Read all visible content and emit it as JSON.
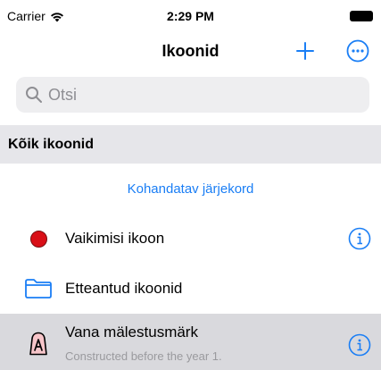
{
  "status_bar": {
    "carrier": "Carrier",
    "time": "2:29 PM"
  },
  "nav": {
    "title": "Ikoonid",
    "add_icon": "plus-icon",
    "more_icon": "ellipsis-circle-icon"
  },
  "search": {
    "placeholder": "Otsi",
    "value": ""
  },
  "section": {
    "header": "Kõik ikoonid",
    "reorder_label": "Kohandatav järjekord"
  },
  "rows": [
    {
      "label": "Vaikimisi ikoon",
      "icon": "red-dot-icon",
      "has_info": true
    },
    {
      "label": "Etteantud ikoonid",
      "icon": "folder-icon",
      "has_info": false
    },
    {
      "label": "Vana mälestusmärk",
      "subtitle": "Constructed before the year 1.",
      "icon": "monument-a-icon",
      "has_info": true,
      "highlighted": true
    }
  ],
  "colors": {
    "accent": "#1a7ef5",
    "red_marker": "#d90f17",
    "section_bg": "#e6e6ea",
    "selected_row_bg": "#d9d9dd"
  }
}
